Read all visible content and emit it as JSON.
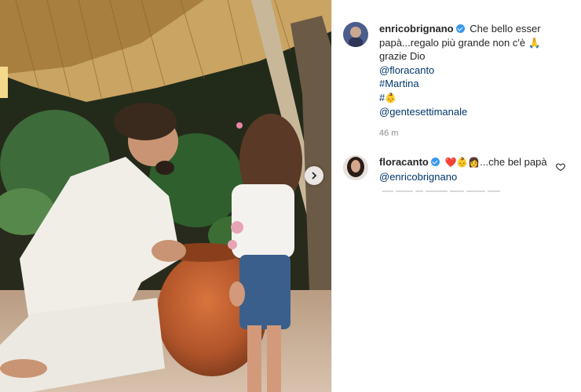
{
  "post": {
    "author": "enricobrignano",
    "caption_lines": [
      "Che bello esser papà...regalo più grande non c'è 🙏",
      "grazie Dio"
    ],
    "mention_1": "@floracanto",
    "hashtag_1": "#Martina",
    "hashtag_2_prefix": "#",
    "hashtag_2_emoji": "👶",
    "mention_2": "@gentesettimanale",
    "time": "46 m"
  },
  "comment": {
    "author": "floracanto",
    "emojis": "❤️👶👩",
    "text": "...che bel papà",
    "mention": "@enricobrignano"
  },
  "icons": {
    "verified": "verified-badge-icon",
    "carousel": "chevron-right-icon",
    "like": "heart-outline-icon"
  },
  "colors": {
    "verified": "#3897f0",
    "link": "#00376b",
    "muted": "#8e8e8e"
  }
}
